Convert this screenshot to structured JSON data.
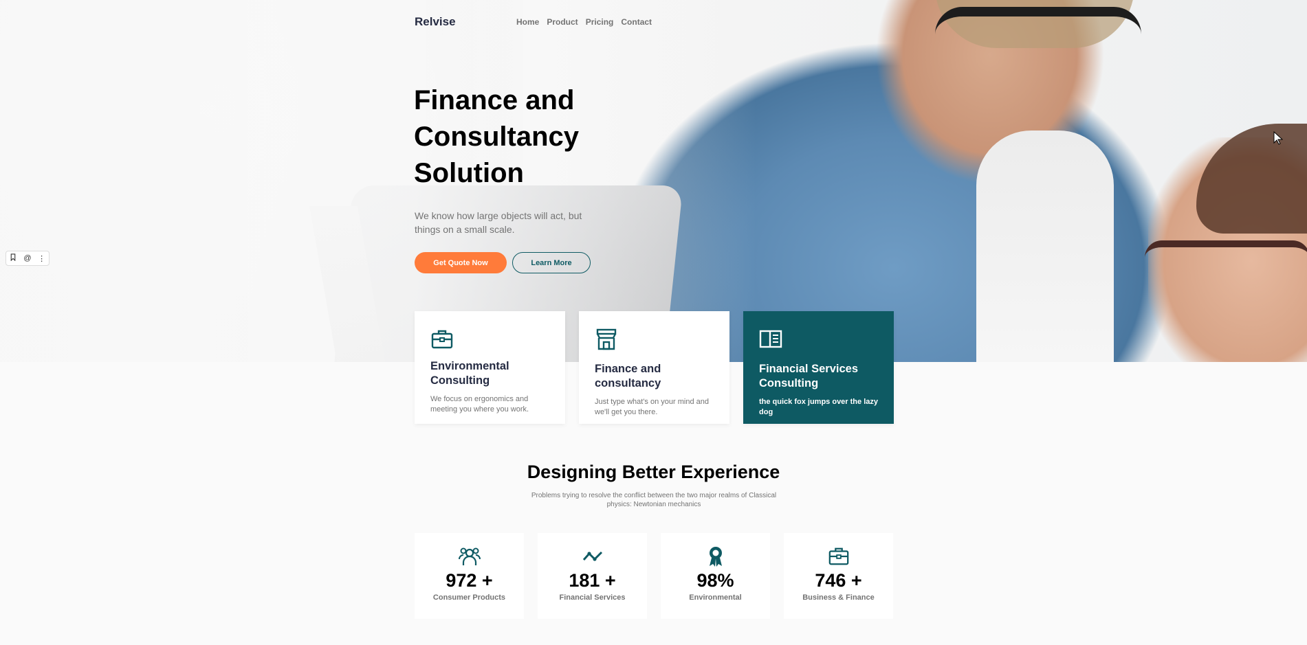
{
  "nav": {
    "brand": "Relvise",
    "links": [
      "Home",
      "Product",
      "Pricing",
      "Contact"
    ]
  },
  "hero": {
    "title_lines": [
      "Finance and",
      "Consultancy",
      "Solution"
    ],
    "subtitle": "We know how large objects will act, but things on a small scale.",
    "primary_button": "Get Quote Now",
    "secondary_button": "Learn More"
  },
  "services": [
    {
      "icon": "briefcase-icon",
      "title": "Environmental Consulting",
      "text": "We focus on ergonomics and meeting you where you work."
    },
    {
      "icon": "store-icon",
      "title": "Finance and consultancy",
      "text": "Just type what's on your mind and we'll get you there."
    },
    {
      "icon": "book-open-icon",
      "title": "Financial Services Consulting",
      "text": "the quick fox jumps over the lazy dog"
    }
  ],
  "section": {
    "title": "Designing Better Experience",
    "subtitle": "Problems trying to resolve the conflict between the two major realms of Classical physics: Newtonian mechanics"
  },
  "stats": [
    {
      "icon": "users-icon",
      "value": "972 +",
      "label": "Consumer Products"
    },
    {
      "icon": "trend-line-icon",
      "value": "181 +",
      "label": "Financial Services"
    },
    {
      "icon": "award-icon",
      "value": "98%",
      "label": "Environmental"
    },
    {
      "icon": "briefcase-icon",
      "value": "746 +",
      "label": "Business & Finance"
    }
  ],
  "colors": {
    "accent_orange": "#ff7b3a",
    "brand_teal": "#0e5a63",
    "heading": "#252b42",
    "muted": "#737373"
  }
}
